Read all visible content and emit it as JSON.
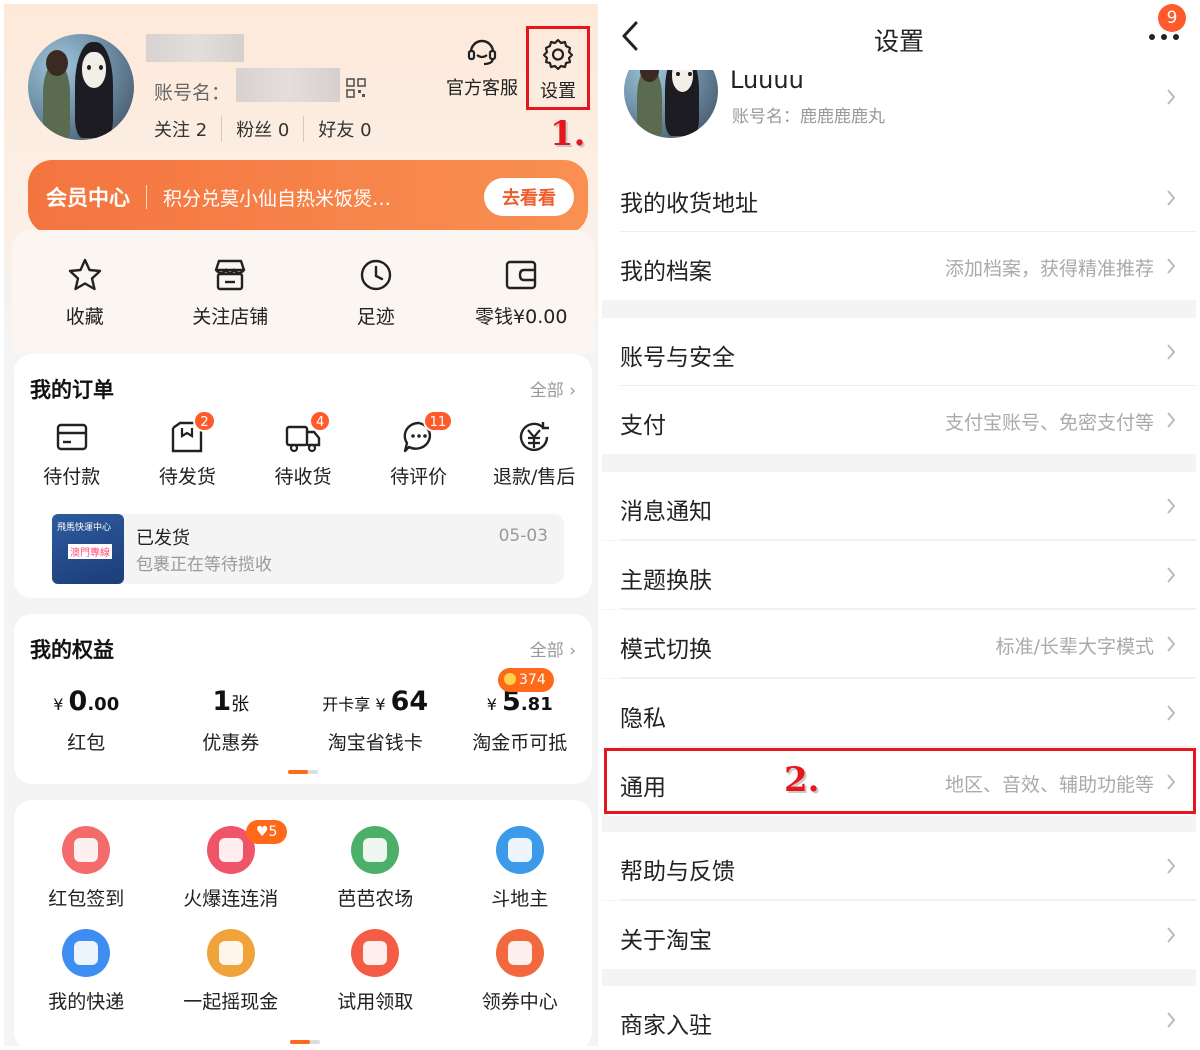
{
  "left": {
    "account_label": "账号名：",
    "stats": [
      {
        "text": "关注 2"
      },
      {
        "text": "粉丝 0"
      },
      {
        "text": "好友 0"
      }
    ],
    "customer_service": "官方客服",
    "settings": "设置",
    "step1": "1.",
    "member": {
      "title": "会员中心",
      "text": "积分兑莫小仙自热米饭煲…",
      "button": "去看看"
    },
    "quick": [
      {
        "label": "收藏",
        "icon": "star-icon"
      },
      {
        "label": "关注店铺",
        "icon": "store-icon"
      },
      {
        "label": "足迹",
        "icon": "clock-icon"
      },
      {
        "label": "零钱¥0.00",
        "icon": "wallet-icon"
      }
    ],
    "orders": {
      "title": "我的订单",
      "all": "全部 ›",
      "items": [
        {
          "label": "待付款",
          "badge": ""
        },
        {
          "label": "待发货",
          "badge": "2"
        },
        {
          "label": "待收货",
          "badge": "4"
        },
        {
          "label": "待评价",
          "badge": "11"
        },
        {
          "label": "退款/售后",
          "badge": ""
        }
      ],
      "shipment": {
        "thumb_line1": "飛馬快運中心",
        "thumb_line2": "澳門專線",
        "status": "已发货",
        "desc": "包裹正在等待揽收",
        "date": "05-03"
      }
    },
    "benefits": {
      "title": "我的权益",
      "all": "全部 ›",
      "coin_badge": "374",
      "items": [
        {
          "prefix": "¥ ",
          "big": "0",
          "small": ".00",
          "label": "红包"
        },
        {
          "prefix": "",
          "big": "1",
          "small": "张",
          "label": "优惠券"
        },
        {
          "prefix": "开卡享 ¥ ",
          "big": "64",
          "small": "",
          "label": "淘宝省钱卡"
        },
        {
          "prefix": "¥ ",
          "big": "5",
          "small": ".81",
          "label": "淘金币可抵"
        }
      ]
    },
    "games": {
      "heart_badge": "♥5",
      "items": [
        {
          "label": "红包签到",
          "color": "#f36b6b"
        },
        {
          "label": "火爆连连消",
          "color": "#f05468"
        },
        {
          "label": "芭芭农场",
          "color": "#4caf6a"
        },
        {
          "label": "斗地主",
          "color": "#3c9be8"
        },
        {
          "label": "我的快递",
          "color": "#3d8ef0"
        },
        {
          "label": "一起摇现金",
          "color": "#f0a33a"
        },
        {
          "label": "试用领取",
          "color": "#f35d45"
        },
        {
          "label": "领券中心",
          "color": "#f2683f"
        }
      ]
    }
  },
  "right": {
    "title": "设置",
    "more_badge": "9",
    "profile": {
      "name": "Luuuu",
      "account": "账号名：鹿鹿鹿鹿丸"
    },
    "step2": "2.",
    "rows": [
      {
        "label": "我的收货地址",
        "value": ""
      },
      {
        "label": "我的档案",
        "value": "添加档案，获得精准推荐"
      },
      {
        "label": "账号与安全",
        "value": ""
      },
      {
        "label": "支付",
        "value": "支付宝账号、免密支付等"
      },
      {
        "label": "消息通知",
        "value": ""
      },
      {
        "label": "主题换肤",
        "value": ""
      },
      {
        "label": "模式切换",
        "value": "标准/长辈大字模式"
      },
      {
        "label": "隐私",
        "value": ""
      },
      {
        "label": "通用",
        "value": "地区、音效、辅助功能等"
      },
      {
        "label": "帮助与反馈",
        "value": ""
      },
      {
        "label": "关于淘宝",
        "value": ""
      },
      {
        "label": "商家入驻",
        "value": ""
      }
    ]
  },
  "colors": {
    "accent": "#ff6a1a",
    "highlight": "#e5161d"
  }
}
